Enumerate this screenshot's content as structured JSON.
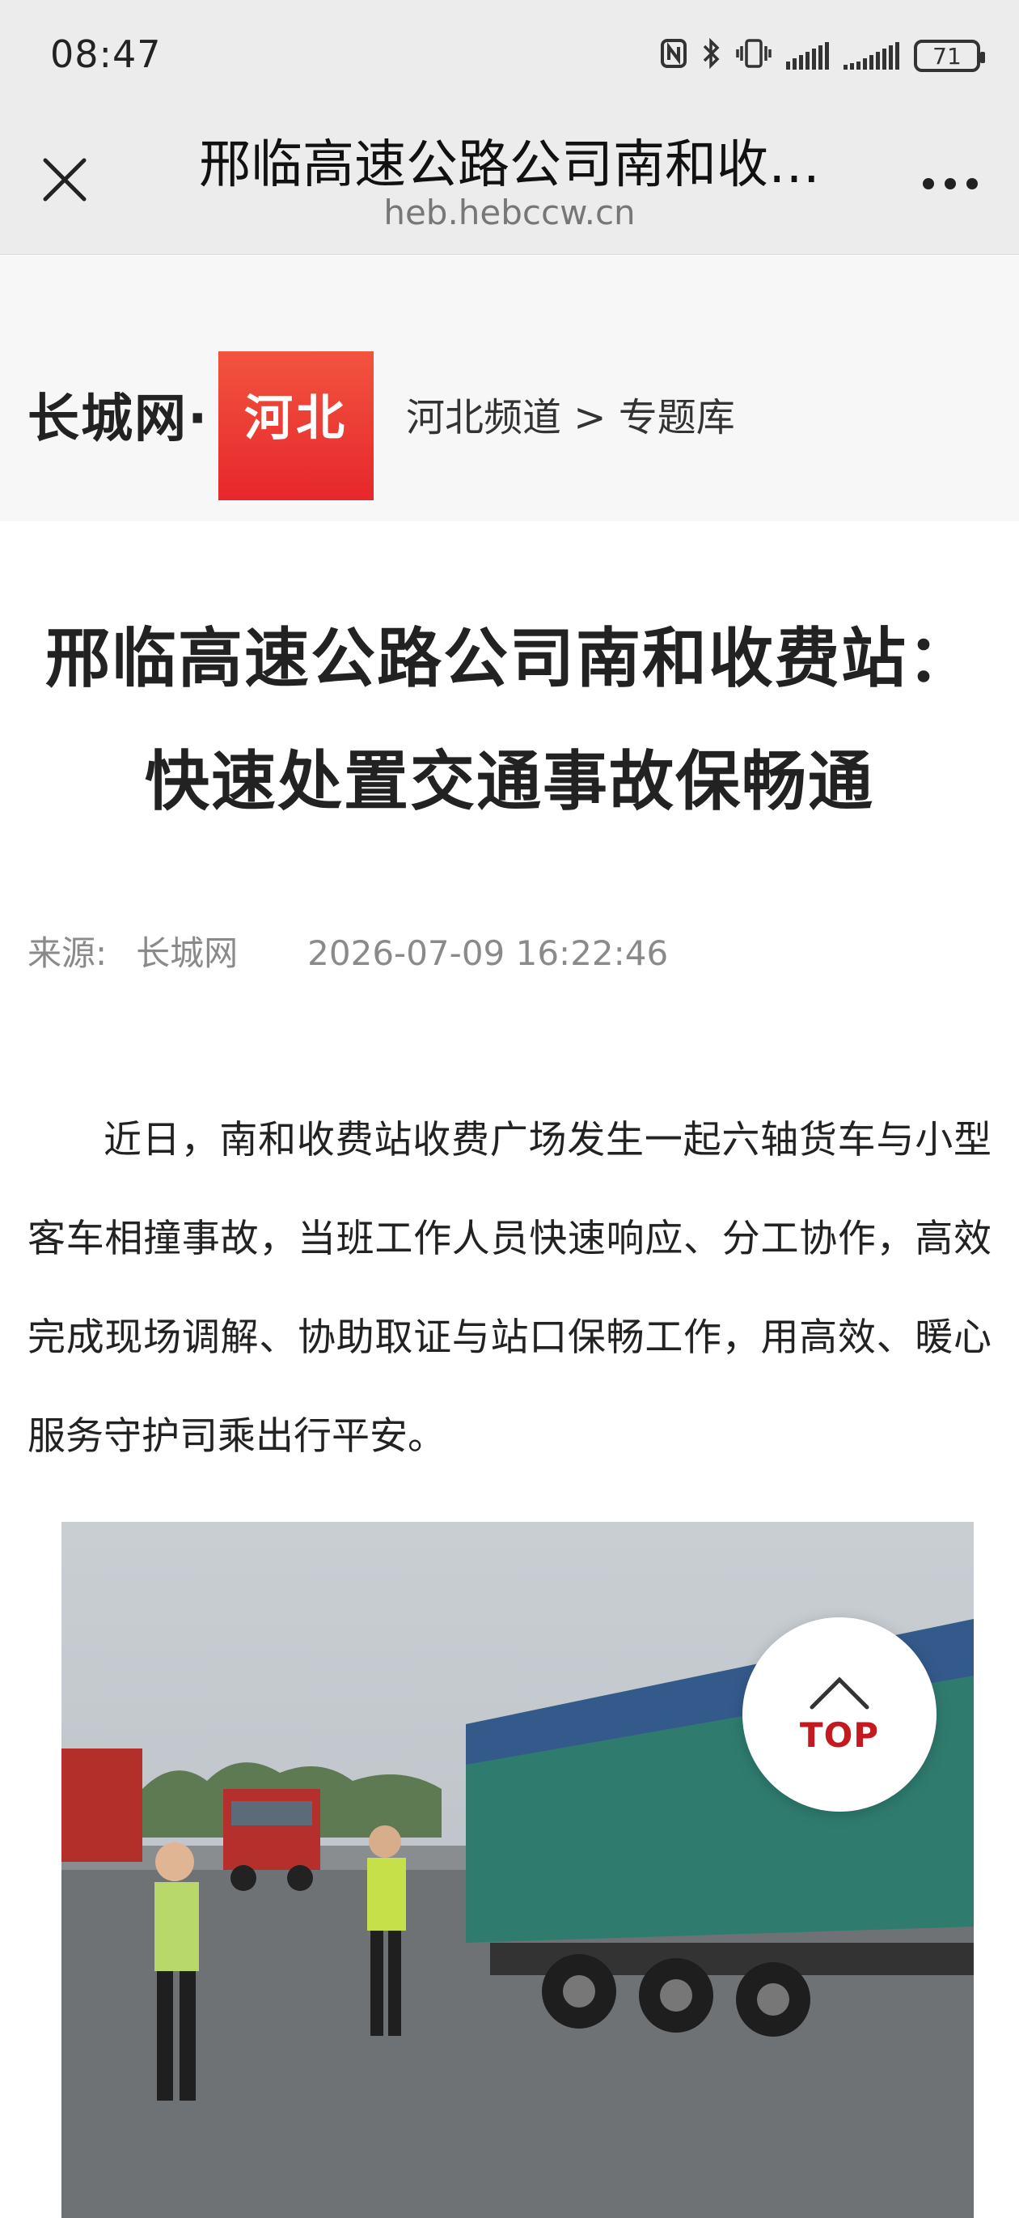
{
  "status_bar": {
    "time": "08:47",
    "battery": "71",
    "icons": [
      "nfc-icon",
      "bluetooth-icon",
      "vibrate-icon",
      "signal-icon",
      "signal-icon"
    ]
  },
  "nav": {
    "title": "邢临高速公路公司南和收…",
    "url": "heb.hebccw.cn",
    "close_icon": "close-icon",
    "more_icon": "more-icon"
  },
  "site": {
    "logo_text": "长城网·",
    "logo_badge": "河北",
    "breadcrumb": "河北频道 > 专题库",
    "badge_color": "#e7272c"
  },
  "article": {
    "title": "邢临高速公路公司南和收费站：快速处置交通事故保畅通",
    "source_label": "来源:",
    "source": "长城网",
    "datetime": "2026-07-09 16:22:46",
    "body": "近日，南和收费站收费广场发生一起六轴货车与小型客车相撞事故，当班工作人员快速响应、分工协作，高效完成现场调解、协助取证与站口保畅工作，用高效、暖心服务守护司乘出行平安。"
  },
  "top_button": {
    "label": "TOP",
    "icon": "chevron-up-icon",
    "color": "#c41a1f"
  }
}
